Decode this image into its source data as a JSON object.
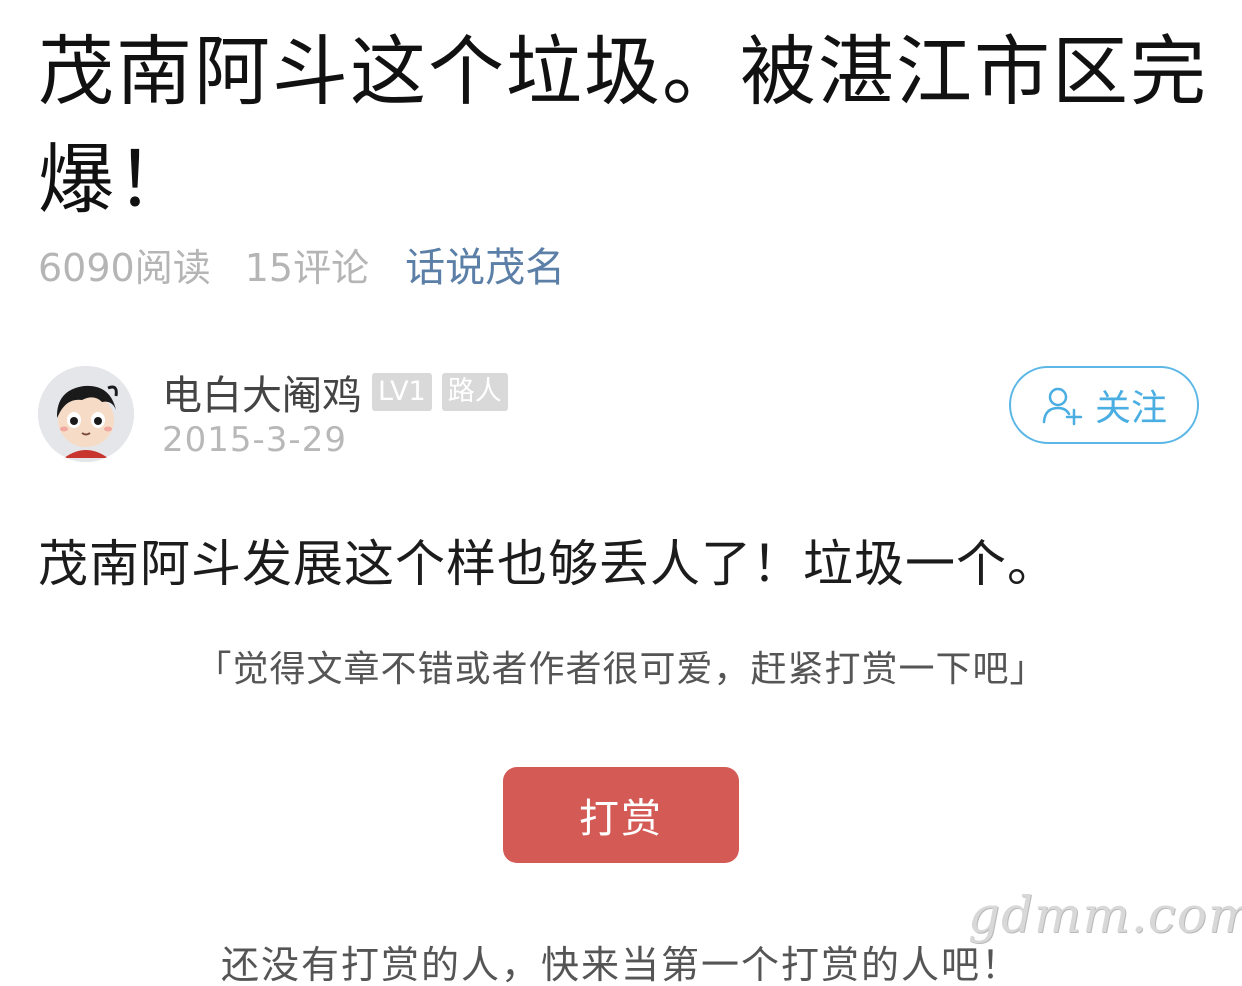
{
  "post": {
    "title": "茂南阿斗这个垃圾。被湛江市区完爆！",
    "reads": "6090阅读",
    "comments": "15评论",
    "board": "话说茂名"
  },
  "author": {
    "name": "电白大阉鸡",
    "level_badge": "LV1",
    "rank_badge": "路人",
    "date": "2015-3-29",
    "follow_label": "关注"
  },
  "content": {
    "text": "茂南阿斗发展这个样也够丢人了！垃圾一个。"
  },
  "reward": {
    "hint": "「觉得文章不错或者作者很可爱，赶紧打赏一下吧」",
    "button_label": "打赏",
    "no_reward_text": "还没有打赏的人，快来当第一个打赏的人吧！"
  },
  "watermark": "gdmm.com",
  "colors": {
    "board_link": "#5b7fa6",
    "follow_accent": "#4aaee2",
    "reward_button": "#d45a56"
  }
}
